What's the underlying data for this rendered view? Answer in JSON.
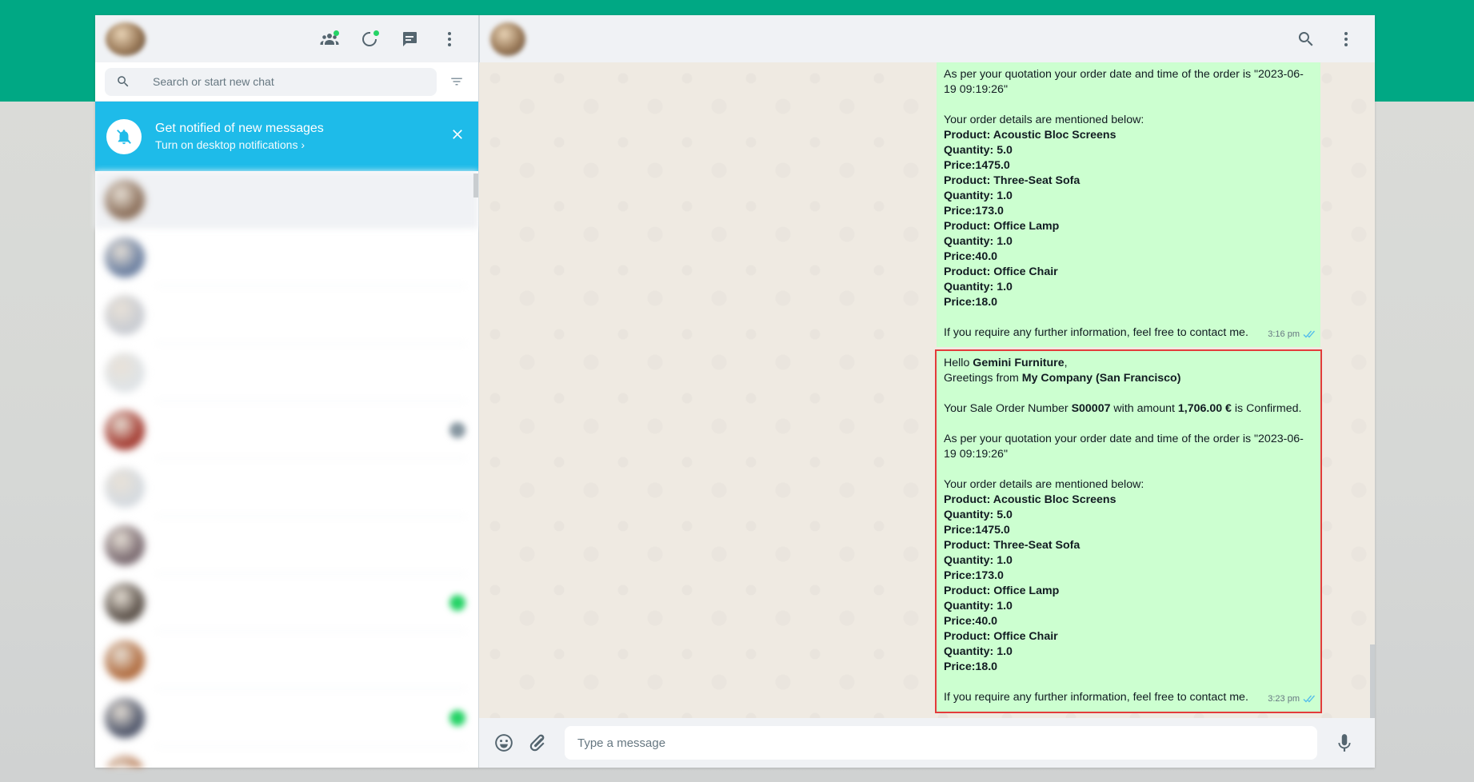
{
  "colors": {
    "accent": "#00a884",
    "notification": "#1ebbe9",
    "bubble": "#ccffd0",
    "highlight_border": "#e33b3b",
    "read_ticks": "#53bdeb"
  },
  "sidebar": {
    "header_icons": [
      "communities-icon",
      "status-icon",
      "new-chat-icon",
      "menu-icon"
    ],
    "search": {
      "placeholder": "Search or start new chat",
      "value": ""
    },
    "notification": {
      "title": "Get notified of new messages",
      "subtitle": "Turn on desktop notifications ›"
    },
    "chats": [
      {
        "name": "",
        "preview": "",
        "time": "",
        "active": true
      },
      {
        "name": "",
        "preview": "",
        "time": ""
      },
      {
        "name": "",
        "preview": "",
        "time": ""
      },
      {
        "name": "",
        "preview": "",
        "time": ""
      },
      {
        "name": "",
        "preview": "",
        "time": "",
        "badge": "",
        "badge_style": "grey"
      },
      {
        "name": "",
        "preview": "",
        "time": ""
      },
      {
        "name": "",
        "preview": "",
        "time": ""
      },
      {
        "name": "",
        "preview": "",
        "time": "",
        "time_green": true,
        "badge": ""
      },
      {
        "name": "",
        "preview": "",
        "time": ""
      },
      {
        "name": "",
        "preview": "",
        "time": "",
        "time_green": true,
        "badge": ""
      },
      {
        "name": "",
        "preview": "",
        "time": ""
      }
    ]
  },
  "conversation": {
    "contact_name": "",
    "contact_status": "",
    "composer_placeholder": "Type a message",
    "messages": [
      {
        "id": "first",
        "intro_a": "",
        "intro_b": "",
        "intro_c": "",
        "order_line": "",
        "quotation": "As per your quotation your order date and time of the order is \"2023-06-19 09:19:26\"",
        "details_heading": "Your order details are mentioned below:",
        "items": [
          {
            "product": "Product: Acoustic Bloc Screens",
            "quantity": "Quantity: 5.0",
            "price": "Price:1475.0"
          },
          {
            "product": "Product: Three-Seat Sofa",
            "quantity": "Quantity: 1.0",
            "price": "Price:173.0"
          },
          {
            "product": "Product: Office Lamp",
            "quantity": "Quantity: 1.0",
            "price": "Price:40.0"
          },
          {
            "product": "Product: Office Chair",
            "quantity": "Quantity: 1.0",
            "price": "Price:18.0"
          }
        ],
        "closing": "If you require any further information, feel free to contact me.",
        "time": "3:16 pm"
      },
      {
        "id": "second",
        "hello": "Hello ",
        "customer": "Gemini Furniture",
        "comma": ",",
        "greetings": "Greetings from ",
        "company": "My Company (San Francisco)",
        "order_pre": "Your Sale Order Number ",
        "order_no": "S00007",
        "order_mid": " with amount ",
        "amount": "1,706.00 €",
        "order_post": " is Confirmed.",
        "quotation": "As per your quotation your order date and time of the order is \"2023-06-19 09:19:26\"",
        "details_heading": "Your order details are mentioned below:",
        "items": [
          {
            "product": "Product: Acoustic Bloc Screens",
            "quantity": "Quantity: 5.0",
            "price": "Price:1475.0"
          },
          {
            "product": "Product: Three-Seat Sofa",
            "quantity": "Quantity: 1.0",
            "price": "Price:173.0"
          },
          {
            "product": "Product: Office Lamp",
            "quantity": "Quantity: 1.0",
            "price": "Price:40.0"
          },
          {
            "product": "Product: Office Chair",
            "quantity": "Quantity: 1.0",
            "price": "Price:18.0"
          }
        ],
        "closing": "If you require any further information, feel free to contact me.",
        "time": "3:23 pm"
      }
    ]
  }
}
